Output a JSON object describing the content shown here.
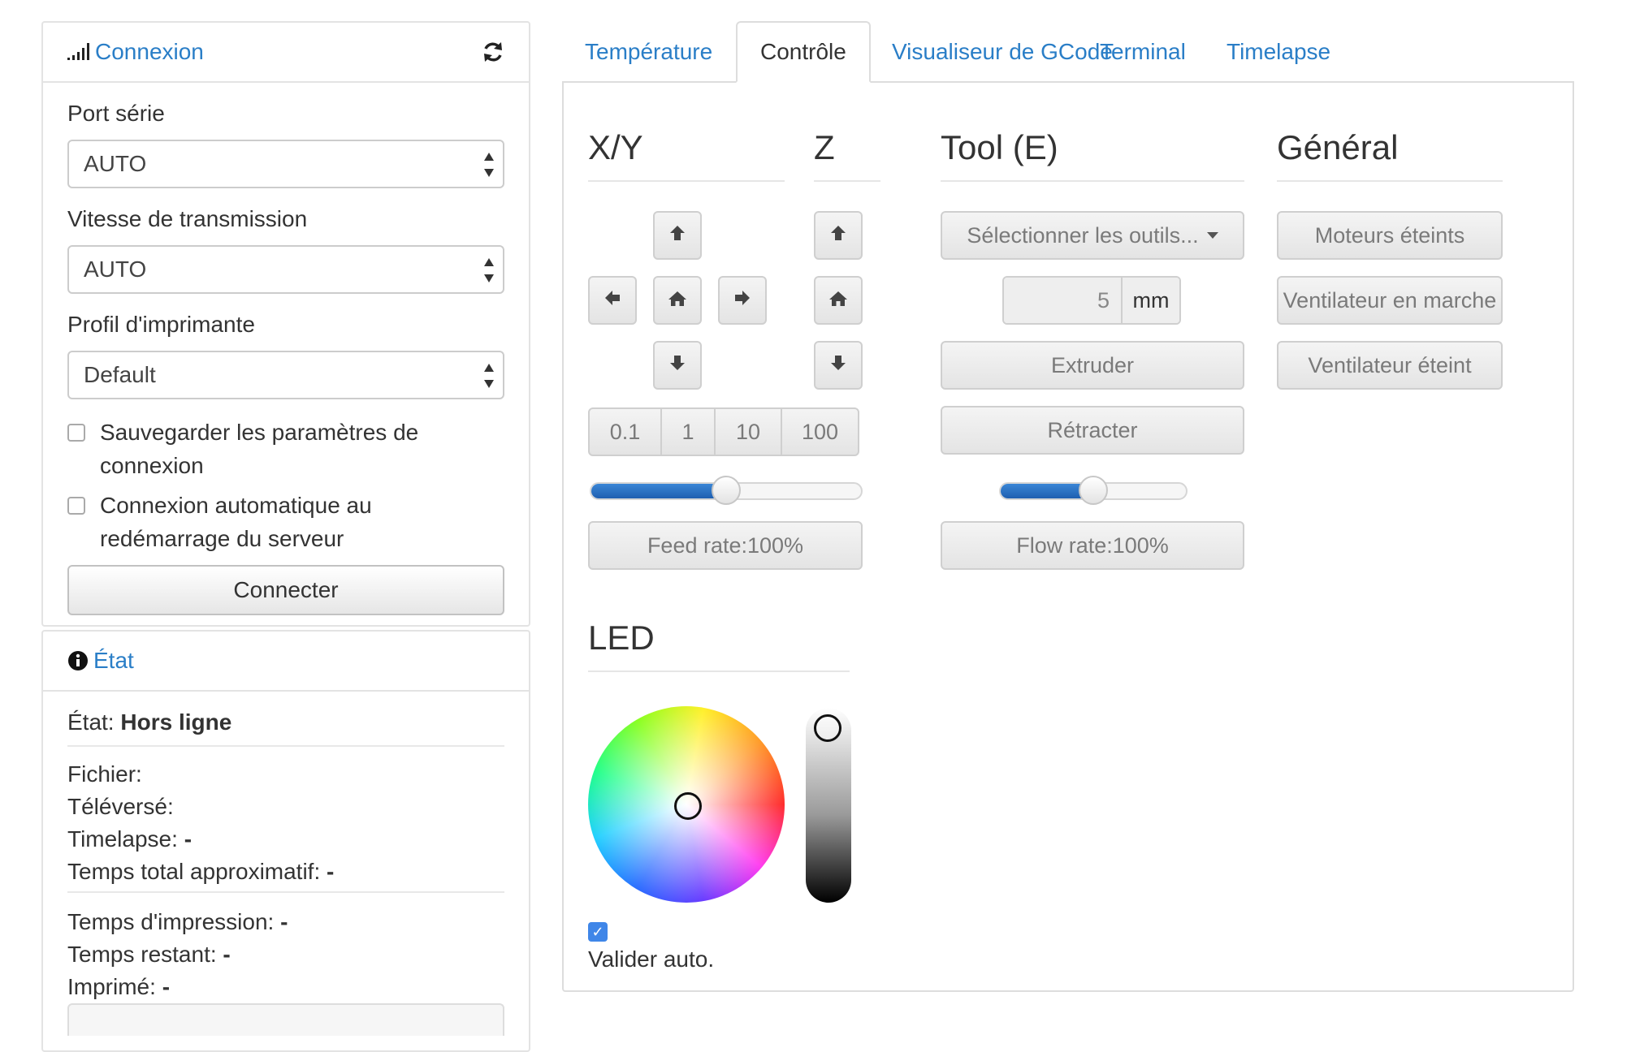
{
  "connection": {
    "title": "Connexion",
    "port_label": "Port série",
    "port_value": "AUTO",
    "baud_label": "Vitesse de transmission",
    "baud_value": "AUTO",
    "profile_label": "Profil d'imprimante",
    "profile_value": "Default",
    "save_line1": "Sauvegarder les paramètres de",
    "save_line2": "connexion",
    "auto_line1": "Connexion automatique au",
    "auto_line2": "redémarrage du serveur",
    "connect_button": "Connecter"
  },
  "state": {
    "title": "État",
    "state_label": "État:",
    "state_value": "Hors ligne",
    "file_label": "Fichier:",
    "uploaded_label": "Téléversé:",
    "timelapse_label": "Timelapse:",
    "timelapse_value": "-",
    "total_time_label": "Temps total approximatif:",
    "total_time_value": "-",
    "print_time_label": "Temps d'impression:",
    "print_time_value": "-",
    "remaining_label": "Temps restant:",
    "remaining_value": "-",
    "printed_label": "Imprimé:",
    "printed_value": "-"
  },
  "tabs": [
    "Température",
    "Contrôle",
    "Visualiseur de GCode",
    "Terminal",
    "Timelapse"
  ],
  "active_tab": "Contrôle",
  "control": {
    "xy_title": "X/Y",
    "z_title": "Z",
    "tool_title": "Tool (E)",
    "general_title": "Général",
    "steps": [
      "0.1",
      "1",
      "10",
      "100"
    ],
    "feed_rate_label": "Feed rate:100%",
    "feed_rate_percent": 50,
    "tool_select_label": "Sélectionner les outils...",
    "extrude_amount": "5",
    "extrude_unit": "mm",
    "extrude_button": "Extruder",
    "retract_button": "Rétracter",
    "flow_rate_label": "Flow rate:100%",
    "flow_rate_percent": 50,
    "motors_off_button": "Moteurs éteints",
    "fan_on_button": "Ventilateur en marche",
    "fan_off_button": "Ventilateur éteint",
    "led_title": "LED",
    "auto_validate_label": "Valider auto.",
    "auto_validate_checked": true
  },
  "colors": {
    "link": "#2a7ec7",
    "slider_fill": "#2a6fc4",
    "checkbox_checked": "#3f86e8"
  },
  "icons": {
    "signal": "signal-icon",
    "refresh": "refresh-icon",
    "info": "info-circle-icon",
    "up": "arrow-up-icon",
    "down": "arrow-down-icon",
    "left": "arrow-left-icon",
    "right": "arrow-right-icon",
    "home": "home-icon"
  }
}
